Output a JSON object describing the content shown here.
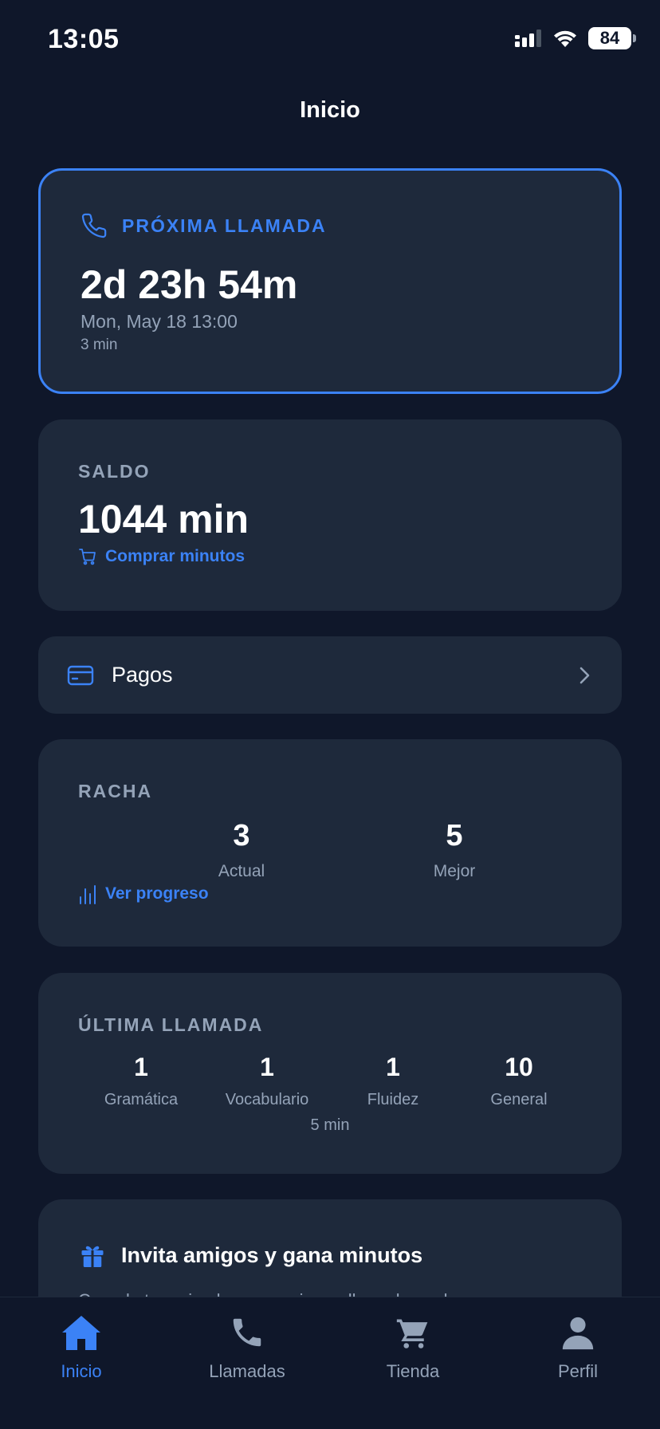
{
  "status_bar": {
    "time": "13:05",
    "battery": "84"
  },
  "header": {
    "title": "Inicio"
  },
  "next_call": {
    "label": "PRÓXIMA LLAMADA",
    "countdown": "2d 23h 54m",
    "datetime": "Mon, May 18 13:00",
    "duration": "3 min",
    "icon": "phone-icon"
  },
  "balance": {
    "label": "SALDO",
    "value": "1044 min",
    "buy_label": "Comprar minutos",
    "icon": "cart-icon"
  },
  "payments": {
    "label": "Pagos",
    "icon": "credit-card-icon"
  },
  "streak": {
    "label": "RACHA",
    "current_value": "3",
    "current_label": "Actual",
    "best_value": "5",
    "best_label": "Mejor",
    "progress_label": "Ver progreso"
  },
  "last_call": {
    "label": "ÚLTIMA LLAMADA",
    "stats": [
      {
        "value": "1",
        "label": "Gramática"
      },
      {
        "value": "1",
        "label": "Vocabulario"
      },
      {
        "value": "1",
        "label": "Fluidez"
      },
      {
        "value": "10",
        "label": "General"
      }
    ],
    "duration": "5 min"
  },
  "invite": {
    "title": "Invita amigos y gana minutos",
    "text": "Cuando tu amigo haga su primera llamada, ambos"
  },
  "tabs": [
    {
      "label": "Inicio",
      "icon": "home-icon",
      "active": true
    },
    {
      "label": "Llamadas",
      "icon": "phone-icon",
      "active": false
    },
    {
      "label": "Tienda",
      "icon": "cart-icon",
      "active": false
    },
    {
      "label": "Perfil",
      "icon": "user-icon",
      "active": false
    }
  ],
  "colors": {
    "background": "#0f172a",
    "card": "#1e293b",
    "accent": "#3b82f6",
    "muted": "#94a3b8"
  }
}
